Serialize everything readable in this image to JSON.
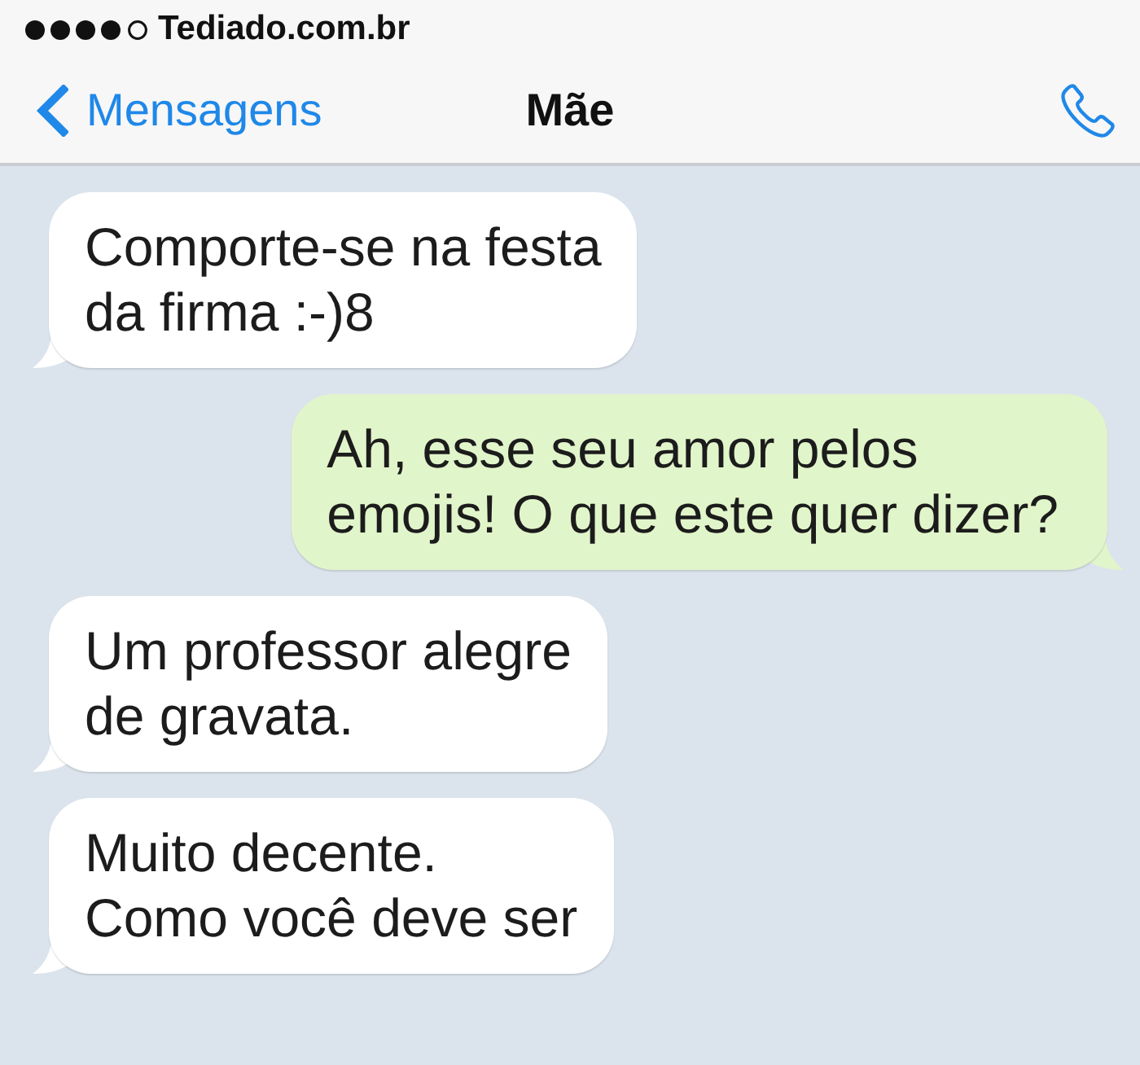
{
  "status_bar": {
    "carrier": "Tediado.com.br"
  },
  "nav_bar": {
    "back_label": "Mensagens",
    "title": "Mãe"
  },
  "messages": [
    {
      "kind": "received",
      "text": "Comporte-se na festa\nda firma :-)8"
    },
    {
      "kind": "sent",
      "text": "Ah, esse seu amor pelos\nemojis! O que este quer dizer?"
    },
    {
      "kind": "received",
      "text": "Um professor alegre\nde gravata."
    },
    {
      "kind": "received",
      "text": "Muito decente.\nComo você deve ser"
    }
  ]
}
